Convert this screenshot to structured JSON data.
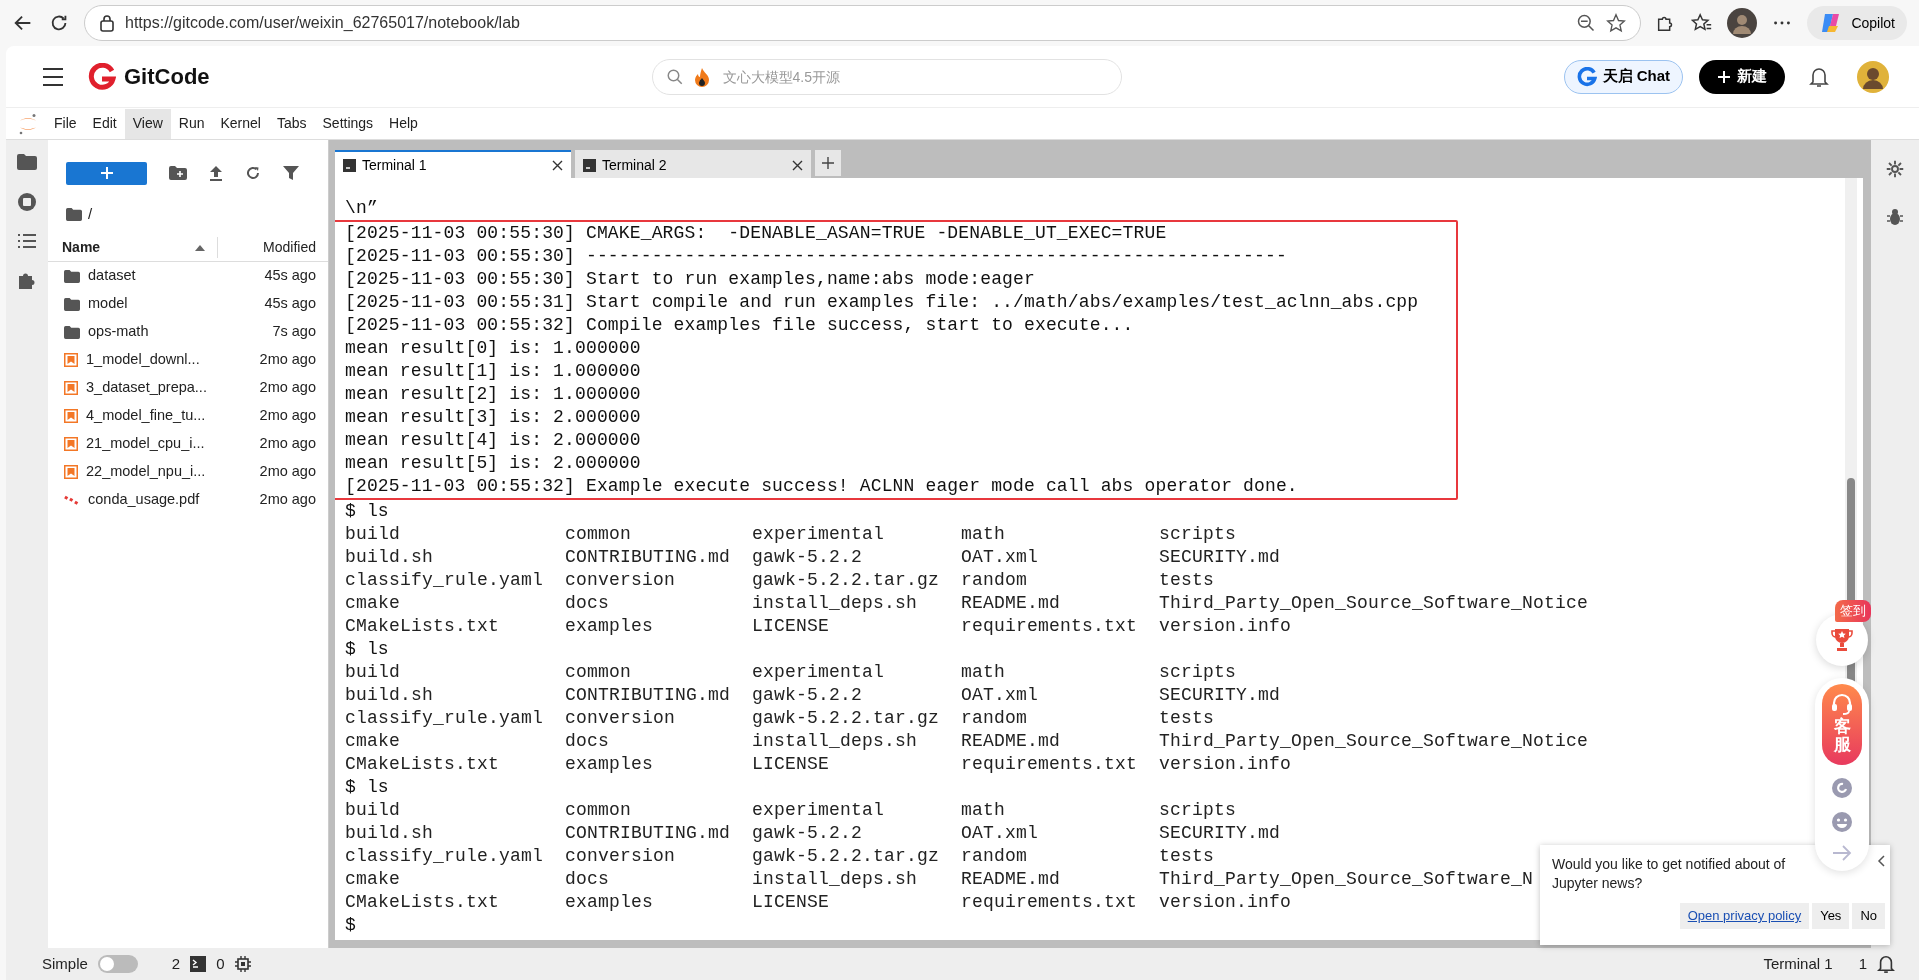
{
  "browser": {
    "url": "https://gitcode.com/user/weixin_62765017/notebook/lab",
    "copilot": "Copilot"
  },
  "header": {
    "brand": "GitCode",
    "search_placeholder": "文心大模型4.5开源",
    "chat_button": "天启 Chat",
    "new_button": "新建"
  },
  "menu": [
    {
      "label": "File",
      "selected": false
    },
    {
      "label": "Edit",
      "selected": false
    },
    {
      "label": "View",
      "selected": true
    },
    {
      "label": "Run",
      "selected": false
    },
    {
      "label": "Kernel",
      "selected": false
    },
    {
      "label": "Tabs",
      "selected": false
    },
    {
      "label": "Settings",
      "selected": false
    },
    {
      "label": "Help",
      "selected": false
    }
  ],
  "file_browser": {
    "path": "/",
    "columns": [
      "Name",
      "Modified"
    ],
    "items": [
      {
        "kind": "folder",
        "name": "dataset",
        "modified": "45s ago"
      },
      {
        "kind": "folder",
        "name": "model",
        "modified": "45s ago"
      },
      {
        "kind": "folder",
        "name": "ops-math",
        "modified": "7s ago"
      },
      {
        "kind": "notebook",
        "name": "1_model_downl...",
        "modified": "2mo ago"
      },
      {
        "kind": "notebook",
        "name": "3_dataset_prepa...",
        "modified": "2mo ago"
      },
      {
        "kind": "notebook",
        "name": "4_model_fine_tu...",
        "modified": "2mo ago"
      },
      {
        "kind": "notebook",
        "name": "21_model_cpu_i...",
        "modified": "2mo ago"
      },
      {
        "kind": "notebook",
        "name": "22_model_npu_i...",
        "modified": "2mo ago"
      },
      {
        "kind": "pdf",
        "name": "conda_usage.pdf",
        "modified": "2mo ago"
      }
    ]
  },
  "tabs": [
    {
      "label": "Terminal 1",
      "selected": true
    },
    {
      "label": "Terminal 2",
      "selected": false
    }
  ],
  "terminal": {
    "blocks": [
      {
        "kind": "plain",
        "lines": [
          {
            "kind": "text",
            "text": "\\n”"
          }
        ]
      },
      {
        "kind": "highlighted",
        "lines": [
          {
            "kind": "text",
            "text": "[2025-11-03 00:55:30] CMAKE_ARGS:  -DENABLE_ASAN=TRUE -DENABLE_UT_EXEC=TRUE"
          },
          {
            "kind": "text",
            "text": "[2025-11-03 00:55:30] ----------------------------------------------------------------"
          },
          {
            "kind": "text",
            "text": "[2025-11-03 00:55:30] Start to run examples,name:abs mode:eager"
          },
          {
            "kind": "text",
            "text": "[2025-11-03 00:55:31] Start compile and run examples file: ../math/abs/examples/test_aclnn_abs.cpp"
          },
          {
            "kind": "text",
            "text": "[2025-11-03 00:55:32] Compile examples file success, start to execute..."
          },
          {
            "kind": "text",
            "text": "mean result[0] is: 1.000000"
          },
          {
            "kind": "text",
            "text": "mean result[1] is: 1.000000"
          },
          {
            "kind": "text",
            "text": "mean result[2] is: 1.000000"
          },
          {
            "kind": "text",
            "text": "mean result[3] is: 2.000000"
          },
          {
            "kind": "text",
            "text": "mean result[4] is: 2.000000"
          },
          {
            "kind": "text",
            "text": "mean result[5] is: 2.000000"
          },
          {
            "kind": "text",
            "text": "[2025-11-03 00:55:32] Example execute success! ACLNN eager mode call abs operator done."
          }
        ]
      },
      {
        "kind": "plain",
        "lines": [
          {
            "kind": "text",
            "text": "$ ls"
          },
          {
            "kind": "columns",
            "cells": [
              "build",
              "common",
              "experimental",
              "math",
              "scripts"
            ]
          },
          {
            "kind": "columns",
            "cells": [
              "build.sh",
              "CONTRIBUTING.md",
              "gawk-5.2.2",
              "OAT.xml",
              "SECURITY.md"
            ]
          },
          {
            "kind": "columns",
            "cells": [
              "classify_rule.yaml",
              "conversion",
              "gawk-5.2.2.tar.gz",
              "random",
              "tests"
            ]
          },
          {
            "kind": "columns",
            "cells": [
              "cmake",
              "docs",
              "install_deps.sh",
              "README.md",
              "Third_Party_Open_Source_Software_Notice"
            ]
          },
          {
            "kind": "columns",
            "cells": [
              "CMakeLists.txt",
              "examples",
              "LICENSE",
              "requirements.txt",
              "version.info"
            ]
          },
          {
            "kind": "text",
            "text": "$ ls"
          },
          {
            "kind": "columns",
            "cells": [
              "build",
              "common",
              "experimental",
              "math",
              "scripts"
            ]
          },
          {
            "kind": "columns",
            "cells": [
              "build.sh",
              "CONTRIBUTING.md",
              "gawk-5.2.2",
              "OAT.xml",
              "SECURITY.md"
            ]
          },
          {
            "kind": "columns",
            "cells": [
              "classify_rule.yaml",
              "conversion",
              "gawk-5.2.2.tar.gz",
              "random",
              "tests"
            ]
          },
          {
            "kind": "columns",
            "cells": [
              "cmake",
              "docs",
              "install_deps.sh",
              "README.md",
              "Third_Party_Open_Source_Software_Notice"
            ]
          },
          {
            "kind": "columns",
            "cells": [
              "CMakeLists.txt",
              "examples",
              "LICENSE",
              "requirements.txt",
              "version.info"
            ]
          },
          {
            "kind": "text",
            "text": "$ ls"
          },
          {
            "kind": "columns",
            "cells": [
              "build",
              "common",
              "experimental",
              "math",
              "scripts"
            ]
          },
          {
            "kind": "columns",
            "cells": [
              "build.sh",
              "CONTRIBUTING.md",
              "gawk-5.2.2",
              "OAT.xml",
              "SECURITY.md"
            ]
          },
          {
            "kind": "columns",
            "cells": [
              "classify_rule.yaml",
              "conversion",
              "gawk-5.2.2.tar.gz",
              "random",
              "tests"
            ]
          },
          {
            "kind": "columns",
            "cells": [
              "cmake",
              "docs",
              "install_deps.sh",
              "README.md",
              "Third_Party_Open_Source_Software_N"
            ]
          },
          {
            "kind": "columns",
            "cells": [
              "CMakeLists.txt",
              "examples",
              "LICENSE",
              "requirements.txt",
              "version.info"
            ]
          },
          {
            "kind": "text",
            "text": "$"
          }
        ]
      }
    ]
  },
  "float_widget": {
    "badge": "签到",
    "service": "客服"
  },
  "notice": {
    "message": "Would you like to get notified about of Jupyter news?",
    "link": "Open privacy policy",
    "buttons": [
      "Yes",
      "No"
    ]
  },
  "status": {
    "mode": "Simple",
    "simple_on": false,
    "terminals": "2",
    "kernels": "0",
    "current": "Terminal 1",
    "notifications": "1"
  }
}
